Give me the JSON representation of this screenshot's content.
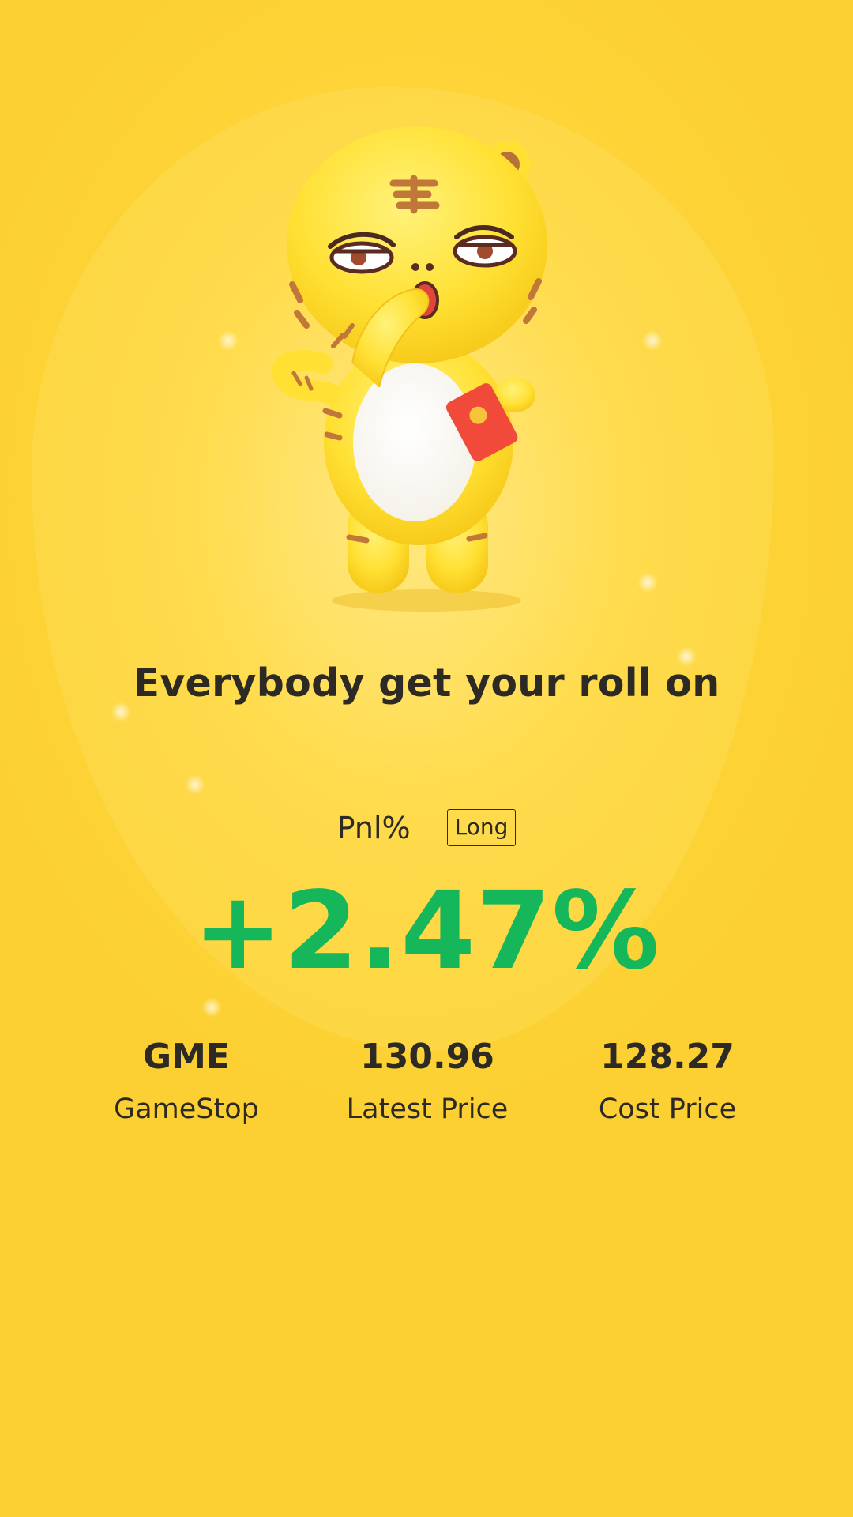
{
  "card": {
    "headline": "Everybody get your roll on",
    "pnl_label": "Pnl%",
    "direction": "Long",
    "pnl_value": "+2.47%",
    "pnl_color": "#16b65a",
    "background_color": "#fdd235",
    "mascot": "tiger-mascot-holding-red-envelope-icon"
  },
  "stats": [
    {
      "value": "GME",
      "label": "GameStop"
    },
    {
      "value": "130.96",
      "label": "Latest Price"
    },
    {
      "value": "128.27",
      "label": "Cost Price"
    }
  ]
}
